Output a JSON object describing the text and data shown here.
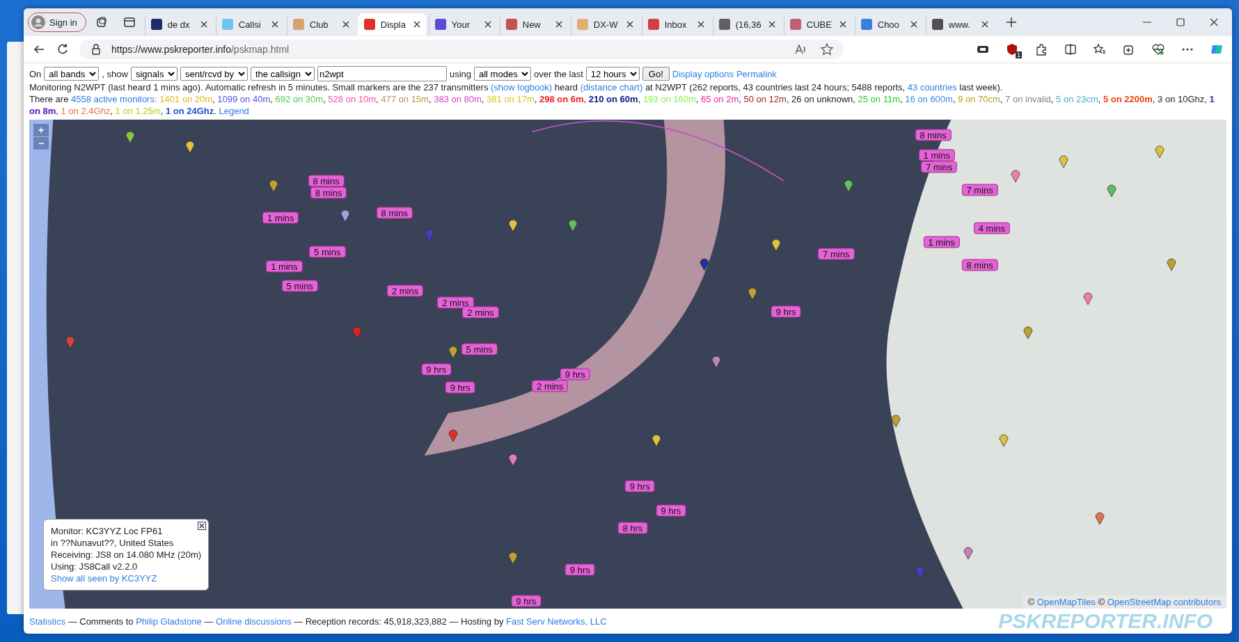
{
  "browser": {
    "sign_in": "Sign in",
    "tabs": [
      {
        "label": "de dx",
        "selected": false,
        "color": "#1d2a6b"
      },
      {
        "label": "Callsi",
        "selected": false,
        "color": "#6fc3f0"
      },
      {
        "label": "Club",
        "selected": false,
        "color": "#d9a070"
      },
      {
        "label": "Displa",
        "selected": true,
        "color": "#e0302a"
      },
      {
        "label": "Your",
        "selected": false,
        "color": "#5a4bd8"
      },
      {
        "label": "New",
        "selected": false,
        "color": "#c85050"
      },
      {
        "label": "DX-W",
        "selected": false,
        "color": "#e0b070"
      },
      {
        "label": "Inbox",
        "selected": false,
        "color": "#d04040"
      },
      {
        "label": "(16,36",
        "selected": false,
        "color": "#606060"
      },
      {
        "label": "CUBE",
        "selected": false,
        "color": "#c06070"
      },
      {
        "label": "Choo",
        "selected": false,
        "color": "#3a80e0"
      },
      {
        "label": "www.",
        "selected": false,
        "color": "#505050"
      }
    ],
    "url_host": "https://www.pskreporter.info",
    "url_path": "/pskmap.html",
    "extension_badge": "1"
  },
  "controls": {
    "on_label": "On",
    "bands": "all bands",
    "show_label": ", show",
    "show": "signals",
    "direction": "sent/rcvd by",
    "target": "the callsign",
    "callsign": "n2wpt",
    "using_label": "using",
    "modes": "all modes",
    "over_label": "over the last",
    "period": "12 hours",
    "go": "Go!",
    "links": [
      "Display options",
      "Permalink"
    ]
  },
  "status_line": [
    {
      "text": "Monitoring N2WPT (last heard 1 mins ago). Automatic refresh in 5 minutes. Small markers are the 237 transmitters "
    },
    {
      "text": "(show logbook)",
      "kind": "link"
    },
    {
      "text": " heard "
    },
    {
      "text": "(distance chart)",
      "kind": "link"
    },
    {
      "text": " at N2WPT (262 reports, 43 countries last 24 hours; 5488 reports, "
    },
    {
      "text": "43 countries",
      "kind": "link"
    },
    {
      "text": " last week)."
    }
  ],
  "monitors_line": [
    {
      "text": "There are "
    },
    {
      "text": "4558 active monitors:",
      "kind": "link"
    },
    {
      "text": " 1401 on 20m",
      "color": "#e8b020"
    },
    {
      "text": ", "
    },
    {
      "text": "1099 on 40m",
      "color": "#5050e8"
    },
    {
      "text": ", "
    },
    {
      "text": "692 on 30m",
      "color": "#50c850"
    },
    {
      "text": ", "
    },
    {
      "text": "528 on 10m",
      "color": "#f050a0"
    },
    {
      "text": ", "
    },
    {
      "text": "477 on 15m",
      "color": "#c09050"
    },
    {
      "text": ", "
    },
    {
      "text": "383 on 80m",
      "color": "#d040d0"
    },
    {
      "text": ", "
    },
    {
      "text": "381 on 17m",
      "color": "#d0c818"
    },
    {
      "text": ", "
    },
    {
      "text": "298 on 6m",
      "color": "#f02020",
      "bold": true
    },
    {
      "text": ", "
    },
    {
      "text": "210 on 60m",
      "color": "#101880",
      "bold": true
    },
    {
      "text": ", "
    },
    {
      "text": "193 on 160m",
      "color": "#80f040"
    },
    {
      "text": ", "
    },
    {
      "text": "65 on 2m",
      "color": "#f02090"
    },
    {
      "text": ", "
    },
    {
      "text": "50 on 12m",
      "color": "#a02020"
    },
    {
      "text": ", 26 on unknown, "
    },
    {
      "text": "25 on 11m",
      "color": "#20d020"
    },
    {
      "text": ", "
    },
    {
      "text": "16 on 600m",
      "color": "#3090e0"
    },
    {
      "text": ", "
    },
    {
      "text": "9 on 70cm",
      "color": "#b0a020"
    },
    {
      "text": ", "
    },
    {
      "text": "7 on invalid",
      "color": "#808080"
    },
    {
      "text": ", "
    },
    {
      "text": "5 on 23cm",
      "color": "#40b0d0"
    },
    {
      "text": ", "
    },
    {
      "text": "5 on 2200m",
      "color": "#f04010",
      "bold": true
    },
    {
      "text": ", 3 on 10Ghz, "
    },
    {
      "text": "1 on 8m",
      "color": "#5010c0",
      "bold": true
    },
    {
      "text": ", "
    },
    {
      "text": "1 on 2.4Ghz",
      "color": "#f07040"
    },
    {
      "text": ", "
    },
    {
      "text": "1 on 1.25m",
      "color": "#b0d010"
    },
    {
      "text": ", "
    },
    {
      "text": "1 on 24Ghz",
      "color": "#2050d0",
      "bold": true
    },
    {
      "text": ". "
    },
    {
      "text": "Legend",
      "kind": "link"
    }
  ],
  "map": {
    "zoom_in": "+",
    "zoom_out": "−",
    "markers": [
      "8 mins",
      "8 mins",
      "1 mins",
      "8 mins",
      "5 mins",
      "1 mins",
      "5 mins",
      "2 mins",
      "2 mins",
      "2 mins",
      "5 mins",
      "9 hrs",
      "9 hrs",
      "9 hrs",
      "2 mins",
      "9 hrs",
      "8 mins",
      "1 mins",
      "7 mins",
      "7 mins",
      "4 mins",
      "1 mins",
      "7 mins",
      "8 mins",
      "9 hrs",
      "9 hrs",
      "8 hrs",
      "9 hrs",
      "9 hrs"
    ],
    "popup": {
      "lines": [
        "Monitor: KC3YYZ Loc FP61",
        "in ??Nunavut??, United States",
        "Receiving: JS8 on 14.080 MHz (20m)",
        "Using: JS8Call v2.2.0"
      ],
      "link": "Show all seen by KC3YYZ"
    },
    "attribution": [
      {
        "text": "© "
      },
      {
        "text": "OpenMapTiles",
        "kind": "link"
      },
      {
        "text": " © "
      },
      {
        "text": "OpenStreetMap contributors",
        "kind": "link"
      }
    ]
  },
  "footer": [
    {
      "text": "Statistics",
      "kind": "link"
    },
    {
      "text": " — Comments to "
    },
    {
      "text": "Philip Gladstone",
      "kind": "link"
    },
    {
      "text": " — "
    },
    {
      "text": "Online discussions",
      "kind": "link"
    },
    {
      "text": " — Reception records: 45,918,323,882 — Hosting by "
    },
    {
      "text": "Fast Serv Networks, LLC",
      "kind": "link"
    }
  ],
  "logo": "PSKREPORTER.INFO"
}
